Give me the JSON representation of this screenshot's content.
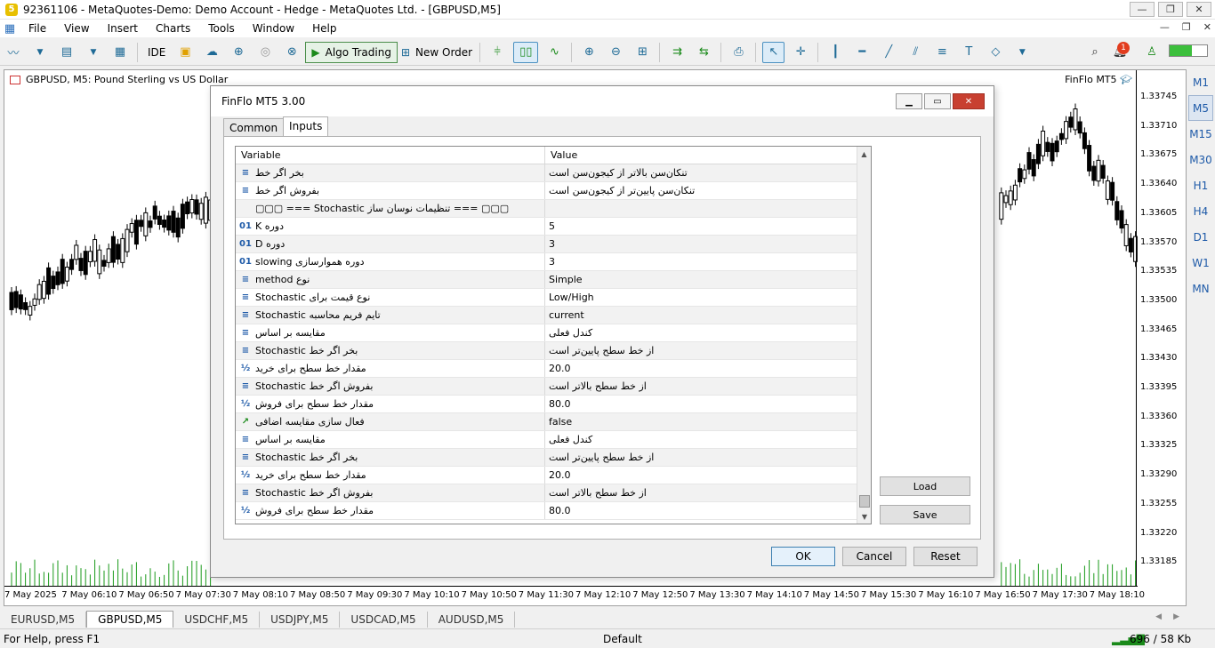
{
  "window": {
    "title": "92361106 - MetaQuotes-Demo: Demo Account - Hedge - MetaQuotes Ltd. - [GBPUSD,M5]",
    "min": "—",
    "restore": "❐",
    "close": "✕"
  },
  "menu": [
    "File",
    "View",
    "Insert",
    "Charts",
    "Tools",
    "Window",
    "Help"
  ],
  "toolbar": {
    "ide": "IDE",
    "algo_trading": "Algo Trading",
    "new_order": "New Order",
    "notification_count": "1"
  },
  "chart": {
    "header": "GBPUSD, M5:  Pound Sterling vs US Dollar",
    "ea_label": "FinFlo MT5",
    "price_ticks": [
      "1.33745",
      "1.33710",
      "1.33675",
      "1.33640",
      "1.33605",
      "1.33570",
      "1.33535",
      "1.33500",
      "1.33465",
      "1.33430",
      "1.33395",
      "1.33360",
      "1.33325",
      "1.33290",
      "1.33255",
      "1.33220",
      "1.33185"
    ],
    "time_ticks": [
      "7 May 2025",
      "7 May 06:10",
      "7 May 06:50",
      "7 May 07:30",
      "7 May 08:10",
      "7 May 08:50",
      "7 May 09:30",
      "7 May 10:10",
      "7 May 10:50",
      "7 May 11:30",
      "7 May 12:10",
      "7 May 12:50",
      "7 May 13:30",
      "7 May 14:10",
      "7 May 14:50",
      "7 May 15:30",
      "7 May 16:10",
      "7 May 16:50",
      "7 May 17:30",
      "7 May 18:10"
    ]
  },
  "timeframes": [
    "M1",
    "M5",
    "M15",
    "M30",
    "H1",
    "H4",
    "D1",
    "W1",
    "MN"
  ],
  "active_timeframe": "M5",
  "symbol_tabs": [
    "EURUSD,M5",
    "GBPUSD,M5",
    "USDCHF,M5",
    "USDJPY,M5",
    "USDCAD,M5",
    "AUDUSD,M5"
  ],
  "active_symbol_tab": "GBPUSD,M5",
  "status": {
    "help": "For Help, press F1",
    "profile": "Default",
    "traffic": "696 / 58 Kb"
  },
  "dialog": {
    "title": "FinFlo MT5 3.00",
    "tabs": [
      "Common",
      "Inputs"
    ],
    "active_tab": "Inputs",
    "columns": [
      "Variable",
      "Value"
    ],
    "rows": [
      {
        "icon": "enum",
        "variable": "بخر اگر خط",
        "value": "تنکان‌سن بالاتر از کیجون‌سن است"
      },
      {
        "icon": "enum",
        "variable": "بفروش اگر خط",
        "value": "تنکان‌سن پایین‌تر از کیجون‌سن است"
      },
      {
        "icon": "string",
        "variable": "▢▢▢ === Stochastic تنظیمات نوسان ساز === ▢▢▢",
        "value": ""
      },
      {
        "icon": "int",
        "variable": "K دوره",
        "value": "5"
      },
      {
        "icon": "int",
        "variable": "D دوره",
        "value": "3"
      },
      {
        "icon": "int",
        "variable": "slowing دوره هموارسازی",
        "value": "3"
      },
      {
        "icon": "enum",
        "variable": "method نوع",
        "value": "Simple"
      },
      {
        "icon": "enum",
        "variable": "Stochastic نوع قیمت برای",
        "value": "Low/High"
      },
      {
        "icon": "enum",
        "variable": "Stochastic تایم فریم محاسبه",
        "value": "current"
      },
      {
        "icon": "enum",
        "variable": "مقایسه بر اساس",
        "value": "کندل فعلی"
      },
      {
        "icon": "enum",
        "variable": "Stochastic بخر اگر خط",
        "value": "از خط سطح پایین‌تر است"
      },
      {
        "icon": "double",
        "variable": "مقدار خط سطح برای خرید",
        "value": "20.0"
      },
      {
        "icon": "enum",
        "variable": "Stochastic بفروش اگر خط",
        "value": "از خط سطح بالاتر است"
      },
      {
        "icon": "double",
        "variable": "مقدار خط سطح برای فروش",
        "value": "80.0"
      },
      {
        "icon": "bool",
        "variable": "فعال سازی مقایسه اضافی",
        "value": "false"
      },
      {
        "icon": "enum",
        "variable": "مقایسه بر اساس",
        "value": "کندل فعلی"
      },
      {
        "icon": "enum",
        "variable": "Stochastic بخر اگر خط",
        "value": "از خط سطح پایین‌تر است"
      },
      {
        "icon": "double",
        "variable": "مقدار خط سطح برای خرید",
        "value": "20.0"
      },
      {
        "icon": "enum",
        "variable": "Stochastic بفروش اگر خط",
        "value": "از خط سطح بالاتر است"
      },
      {
        "icon": "double",
        "variable": "مقدار خط سطح برای فروش",
        "value": "80.0"
      }
    ],
    "load": "Load",
    "save": "Save",
    "ok": "OK",
    "cancel": "Cancel",
    "reset": "Reset"
  }
}
